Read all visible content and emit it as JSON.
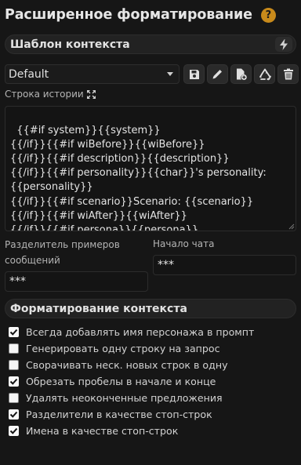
{
  "header": {
    "title": "Расширенное форматирование",
    "help_icon": "?"
  },
  "context_template": {
    "section_title": "Шаблон контекста",
    "selected_template": "Default",
    "story_string_label": "Строка истории",
    "story_string": "{{#if system}}{{system}}\n{{/if}}{{#if wiBefore}}{{wiBefore}}\n{{/if}}{{#if description}}{{description}}\n{{/if}}{{#if personality}}{{char}}'s personality:\n{{personality}}\n{{/if}}{{#if scenario}}Scenario: {{scenario}}\n{{/if}}{{#if wiAfter}}{{wiAfter}}\n{{/if}}{{#if persona}}{{persona}}\n{{/if}}",
    "example_separator_label": "Разделитель примеров сообщений",
    "example_separator_value": "***",
    "chat_start_label": "Начало чата",
    "chat_start_value": "***"
  },
  "context_formatting": {
    "section_title": "Форматирование контекста",
    "options": [
      {
        "label": "Всегда добавлять имя персонажа в промпт",
        "checked": true
      },
      {
        "label": "Генерировать одну строку на запрос",
        "checked": false
      },
      {
        "label": "Сворачивать неск. новых строк в одну",
        "checked": false
      },
      {
        "label": "Обрезать пробелы в начале и конце",
        "checked": true
      },
      {
        "label": "Удалять неоконченные предложения",
        "checked": false
      },
      {
        "label": "Разделители в качестве стоп-строк",
        "checked": true
      },
      {
        "label": "Имена в качестве стоп-строк",
        "checked": true
      }
    ]
  },
  "icons": [
    "help-icon",
    "bolt-icon",
    "chevron-down-icon",
    "save-icon",
    "pencil-icon",
    "file-add-icon",
    "recycle-icon",
    "trash-icon",
    "expand-icon",
    "resize-grip-icon",
    "checkbox-check-icon"
  ],
  "colors": {
    "background": "#161616",
    "accent": "#c88a1b"
  }
}
